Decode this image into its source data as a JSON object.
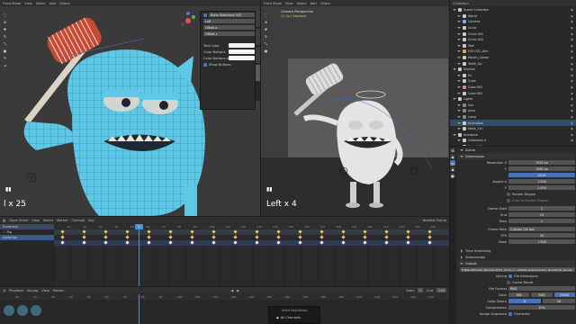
{
  "left_viewport": {
    "header": [
      "Front-Mode",
      "View",
      "Select",
      "Add",
      "Object"
    ],
    "frame_label": "l x 25",
    "sidebar_panel": {
      "name_field": "Bone Sketchout VLP",
      "field2": "LoR",
      "offset_a": "Offset a",
      "offset_b": "Offset ∧",
      "text_color_label": "Text Color",
      "color_buttons_label": "Color Buttons",
      "color_buttons_a_label": "Color Buttons ai",
      "show_buttons_label": "Show Buttons"
    },
    "tabs": [
      "Item",
      "Tool",
      "View",
      "Sketch"
    ]
  },
  "right_viewport": {
    "header": [
      "Front Mode",
      "View",
      "Select",
      "Add",
      "Object"
    ],
    "camera_label": "Camera Perspective",
    "camera_sub": "(1) Ilo | Segment",
    "frame_label": "Left x 4"
  },
  "outliner": {
    "title": "Collection",
    "rows": [
      {
        "label": "Scene Collection",
        "indent": 0,
        "color": "#c8c8c8"
      },
      {
        "label": "World",
        "indent": 1,
        "color": "#c8c8c8"
      },
      {
        "label": "Camera",
        "indent": 1,
        "color": "#7fb0e0"
      },
      {
        "label": "Circle",
        "indent": 1,
        "color": "#c8c8c8"
      },
      {
        "label": "Circle.001",
        "indent": 1,
        "color": "#c8c8c8"
      },
      {
        "label": "Circle.002",
        "indent": 1,
        "color": "#c8c8c8"
      },
      {
        "label": "Text",
        "indent": 1,
        "color": "#c8c8c8"
      },
      {
        "label": "EYE.002_Arm",
        "indent": 1,
        "color": "#e0a060"
      },
      {
        "label": "Mouth_Owner",
        "indent": 1,
        "color": "#c8c8c8"
      },
      {
        "label": "Teeth_Up",
        "indent": 1,
        "color": "#c8c8c8"
      },
      {
        "label": "Symbol",
        "indent": 0,
        "color": "#c8c8c8"
      },
      {
        "label": "Ex",
        "indent": 1,
        "color": "#c8c8c8"
      },
      {
        "label": "Cube",
        "indent": 1,
        "color": "#c8c8c8"
      },
      {
        "label": "Color.001",
        "indent": 1,
        "color": "#e08080"
      },
      {
        "label": "Color.002",
        "indent": 1,
        "color": "#c8c8c8"
      },
      {
        "label": "Lights",
        "indent": 0,
        "color": "#c8c8c8"
      },
      {
        "label": "Sun",
        "indent": 1,
        "color": "#888888"
      },
      {
        "label": "Area",
        "indent": 1,
        "color": "#888888"
      },
      {
        "label": "Lamp",
        "indent": 1,
        "color": "#888888"
      },
      {
        "label": "Animation",
        "indent": 1,
        "color": "#c8c8c8"
      },
      {
        "label": "Mesh_Ctrl",
        "indent": 1,
        "color": "#c8c8c8"
      },
      {
        "label": "Armature",
        "indent": 0,
        "color": "#c8c8c8"
      },
      {
        "label": "Collection.3",
        "indent": 1,
        "color": "#c8c8c8"
      },
      {
        "label": "Panel.001",
        "indent": 1,
        "color": "#c8c8c8"
      },
      {
        "label": "Rig",
        "indent": 0,
        "color": "#c8c8c8"
      }
    ]
  },
  "properties": {
    "section_scene": "Scene",
    "section_dimensions": "Dimensions",
    "resolution_x_label": "Resolution X",
    "resolution_x": "1920 px",
    "resolution_y_label": "Y",
    "resolution_y": "1080 px",
    "resolution_pct": "100%",
    "aspect_x_label": "Aspect X",
    "aspect_x": "1.000",
    "aspect_y_label": "Y",
    "aspect_y": "1.000",
    "render_region_label": "Render Region",
    "crop_label": "Crop to Render Region",
    "frame_start_label": "Frame Start",
    "frame_start": "1",
    "frame_end_label": "End",
    "frame_end": "24",
    "frame_step_label": "Step",
    "frame_step": "1",
    "frame_rate_label": "Frame Rate",
    "frame_rate": "Custom (24 fps)",
    "fps_label": "FPS",
    "fps": "24",
    "base_label": "Base",
    "base": "1.000",
    "time_stretching": "Time Stretching",
    "stereoscopy": "Stereoscopy",
    "section_output": "Output",
    "output_path": "F:\\BlendFiles\\01_Blender\\2023_Script_ll...\\ANIGB_Ipet\\lanim011_Render\\02_Render",
    "saving_label": "Saving",
    "file_extensions": "File Extensions",
    "cache_result": "Cache Result",
    "file_format_label": "File Format",
    "file_format": "PNG",
    "color_label": "Color",
    "color_bw": "BW",
    "color_rgb": "RGB",
    "color_rgba": "RGBA",
    "color_depth_label": "Color Depth",
    "color_depth_8": "8",
    "color_depth_16": "16",
    "compression_label": "Compression",
    "compression": "15%",
    "image_sequence_label": "Image Sequence",
    "overwrite": "Overwrite"
  },
  "dopesheet": {
    "header": [
      "Dope Sheet",
      "View",
      "Select",
      "Marker",
      "Channel",
      "Key"
    ],
    "channels": [
      "Summary",
      "Rig",
      "Agitation"
    ],
    "ticks": [
      "10",
      "20",
      "30",
      "40",
      "50",
      "60",
      "70",
      "80",
      "90",
      "100",
      "110",
      "120",
      "130",
      "140",
      "150",
      "160",
      "170",
      "180",
      "190",
      "200",
      "210",
      "220",
      "230",
      "240"
    ],
    "current_frame": "1",
    "nearest_frame": "Nearest Frame"
  },
  "timeline": {
    "header": [
      "Playback",
      "Keying",
      "View",
      "Marker"
    ],
    "ticks": [
      "10",
      "20",
      "30",
      "40",
      "50",
      "60",
      "70",
      "80",
      "90",
      "100",
      "110",
      "120",
      "130",
      "140",
      "150",
      "160",
      "170",
      "180",
      "190",
      "200",
      "210",
      "220",
      "230",
      "240"
    ],
    "start_label": "Start",
    "start": "1",
    "end_label": "End",
    "end": "240"
  },
  "popup": {
    "title": "Insert Keyframes",
    "item": "All Channels"
  },
  "colors": {
    "accent": "#4a72b8",
    "playhead": "#4a90d9",
    "keyframe": "#e8c75a",
    "monster": "#5ec8e6",
    "viewport_bg": "#3d3d3d"
  }
}
